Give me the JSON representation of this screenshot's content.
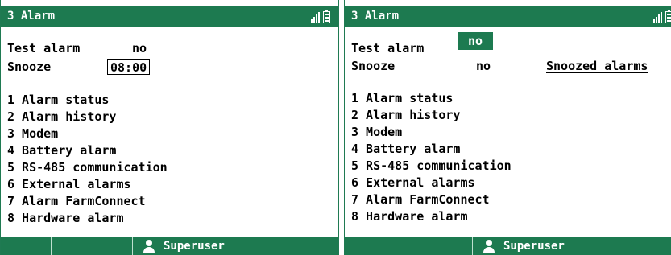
{
  "left": {
    "title": "3 Alarm",
    "test_alarm_label": "Test alarm",
    "test_alarm_value": "no",
    "snooze_label": "Snooze",
    "snooze_value": "08:00",
    "menu": [
      "1 Alarm status",
      "2 Alarm history",
      "3 Modem",
      "4 Battery alarm",
      "5 RS-485 communication",
      "6 External alarms",
      "7 Alarm FarmConnect",
      "8 Hardware alarm"
    ],
    "footer_user": "Superuser"
  },
  "right": {
    "title": "3 Alarm",
    "test_alarm_label": "Test alarm",
    "test_alarm_value": "no",
    "snooze_label": "Snooze",
    "snooze_value": "no",
    "snoozed_alarms_link": "Snoozed alarms",
    "menu": [
      "1 Alarm status",
      "2 Alarm history",
      "3 Modem",
      "4 Battery alarm",
      "5 RS-485 communication",
      "6 External alarms",
      "7 Alarm FarmConnect",
      "8 Hardware alarm"
    ],
    "footer_user": "Superuser"
  },
  "icons": {
    "signal": "signal-strength-icon",
    "battery": "battery-icon",
    "user": "user-icon"
  },
  "colors": {
    "accent": "#1d7a50",
    "background": "#ffffff",
    "text": "#000000"
  }
}
